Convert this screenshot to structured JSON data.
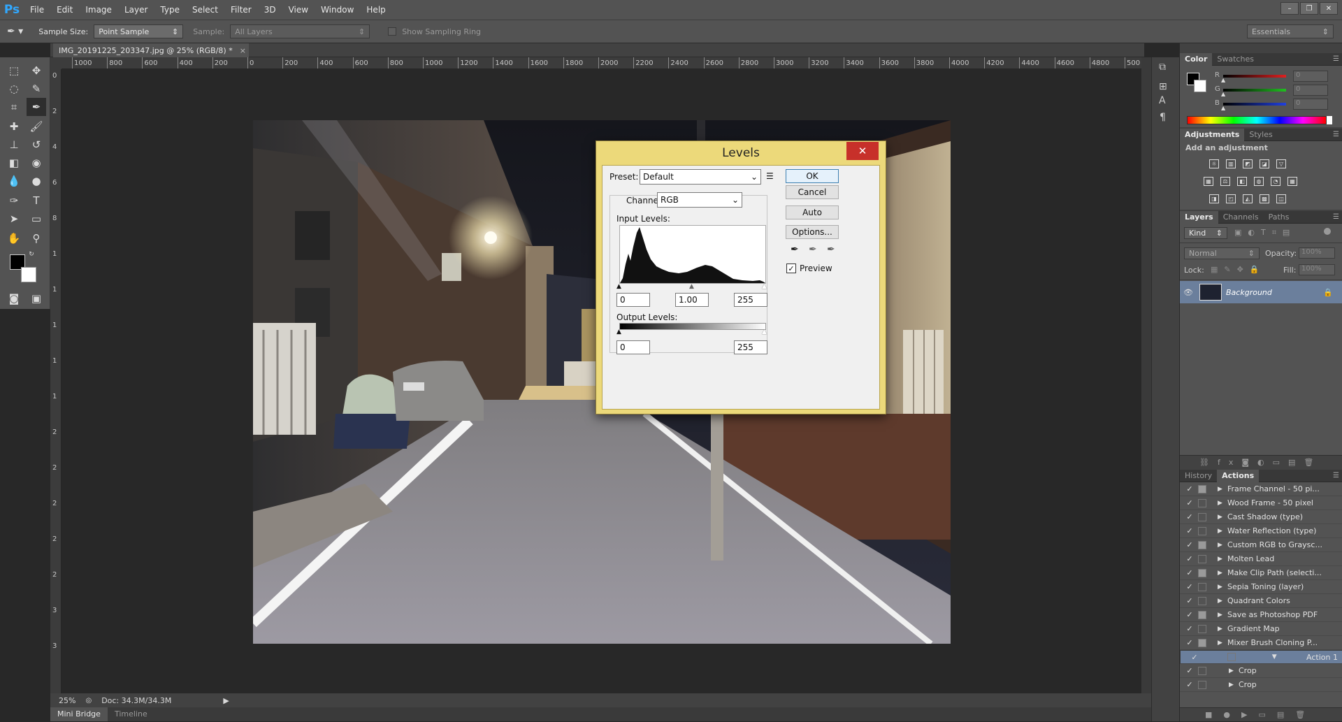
{
  "app": {
    "logo": "Ps"
  },
  "menubar": {
    "items": [
      "File",
      "Edit",
      "Image",
      "Layer",
      "Type",
      "Select",
      "Filter",
      "3D",
      "View",
      "Window",
      "Help"
    ]
  },
  "options": {
    "sample_size_label": "Sample Size:",
    "sample_size_value": "Point Sample",
    "sample_label": "Sample:",
    "sample_value": "All Layers",
    "sampling_ring_label": "Show Sampling Ring",
    "workspace": "Essentials"
  },
  "document": {
    "tab_title": "IMG_20191225_203347.jpg @ 25% (RGB/8) *"
  },
  "ruler": {
    "h_ticks": [
      "1000",
      "800",
      "600",
      "400",
      "200",
      "0",
      "200",
      "400",
      "600",
      "800",
      "1000",
      "1200",
      "1400",
      "1600",
      "1800",
      "2000",
      "2200",
      "2400",
      "2600",
      "2800",
      "3000",
      "3200",
      "3400",
      "3600",
      "3800",
      "4000",
      "4200",
      "4400",
      "4600",
      "4800",
      "500"
    ],
    "v_ticks": [
      "0",
      "2",
      "4",
      "6",
      "8",
      "1",
      "1",
      "1",
      "1",
      "1",
      "2",
      "2",
      "2",
      "2",
      "2",
      "3",
      "3"
    ]
  },
  "status": {
    "zoom": "25%",
    "doc": "Doc: 34.3M/34.3M"
  },
  "bottom_tabs": [
    "Mini Bridge",
    "Timeline"
  ],
  "color_panel": {
    "tabs": [
      "Color",
      "Swatches"
    ],
    "channels": [
      {
        "name": "R",
        "value": "0",
        "color": "#e02020"
      },
      {
        "name": "G",
        "value": "0",
        "color": "#20c020"
      },
      {
        "name": "B",
        "value": "0",
        "color": "#2040e0"
      }
    ]
  },
  "adjustments_panel": {
    "tabs": [
      "Adjustments",
      "Styles"
    ],
    "hint": "Add an adjustment"
  },
  "layers_panel": {
    "tabs": [
      "Layers",
      "Channels",
      "Paths"
    ],
    "filter_kind": "Kind",
    "blend_mode": "Normal",
    "opacity_label": "Opacity:",
    "opacity_value": "100%",
    "lock_label": "Lock:",
    "fill_label": "Fill:",
    "fill_value": "100%",
    "layer_name": "Background"
  },
  "actions_panel": {
    "tabs": [
      "History",
      "Actions"
    ],
    "items": [
      {
        "name": "Frame Channel - 50 pi...",
        "dialog": true,
        "expanded": false,
        "indent": 0
      },
      {
        "name": "Wood Frame - 50 pixel",
        "dialog": false,
        "expanded": false,
        "indent": 0
      },
      {
        "name": "Cast Shadow (type)",
        "dialog": false,
        "expanded": false,
        "indent": 0
      },
      {
        "name": "Water Reflection (type)",
        "dialog": false,
        "expanded": false,
        "indent": 0
      },
      {
        "name": "Custom RGB to Graysc...",
        "dialog": true,
        "expanded": false,
        "indent": 0
      },
      {
        "name": "Molten Lead",
        "dialog": false,
        "expanded": false,
        "indent": 0
      },
      {
        "name": "Make Clip Path (selecti...",
        "dialog": true,
        "expanded": false,
        "indent": 0
      },
      {
        "name": "Sepia Toning (layer)",
        "dialog": false,
        "expanded": false,
        "indent": 0
      },
      {
        "name": "Quadrant Colors",
        "dialog": false,
        "expanded": false,
        "indent": 0
      },
      {
        "name": "Save as Photoshop PDF",
        "dialog": true,
        "expanded": false,
        "indent": 0
      },
      {
        "name": "Gradient Map",
        "dialog": false,
        "expanded": false,
        "indent": 0
      },
      {
        "name": "Mixer Brush Cloning P...",
        "dialog": true,
        "expanded": false,
        "indent": 0
      },
      {
        "name": "Action 1",
        "dialog": false,
        "expanded": true,
        "indent": 0,
        "selected": true
      },
      {
        "name": "Crop",
        "dialog": false,
        "expanded": false,
        "indent": 1
      },
      {
        "name": "Crop",
        "dialog": false,
        "expanded": false,
        "indent": 1
      }
    ]
  },
  "levels_dialog": {
    "title": "Levels",
    "close": "✕",
    "preset_label": "Preset:",
    "preset_value": "Default",
    "channel_label": "Channel:",
    "channel_value": "RGB",
    "input_levels_label": "Input Levels:",
    "input_black": "0",
    "input_gamma": "1.00",
    "input_white": "255",
    "output_levels_label": "Output Levels:",
    "output_black": "0",
    "output_white": "255",
    "buttons": {
      "ok": "OK",
      "cancel": "Cancel",
      "auto": "Auto",
      "options": "Options..."
    },
    "preview_label": "Preview",
    "preview_checked": true
  }
}
